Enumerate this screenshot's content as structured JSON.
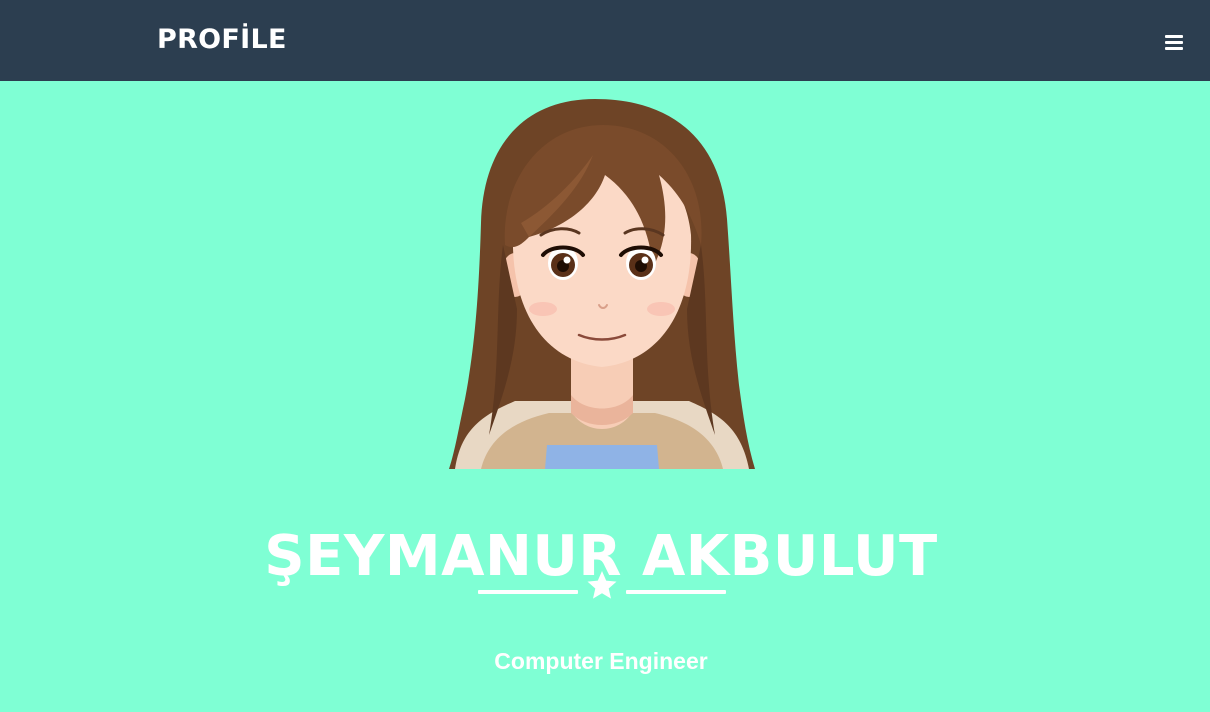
{
  "navbar": {
    "brand": "PROFİLE",
    "menu_icon": "hamburger-menu-icon",
    "background": "#2c3e50"
  },
  "masthead": {
    "background": "#7fffd4",
    "avatar": {
      "description_icon": "cartoon-avatar-girl"
    },
    "name": "ŞEYMANUR AKBULUT",
    "divider_icon": "star-icon",
    "subtitle": "Computer Engineer"
  }
}
